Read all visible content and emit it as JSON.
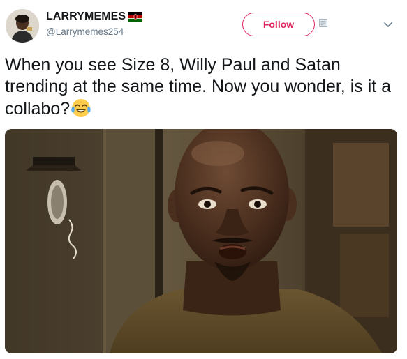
{
  "author": {
    "display_name": "LARRYMEMES",
    "handle": "@Larrymemes254",
    "flag_icon": "kenya-flag-icon"
  },
  "actions": {
    "follow_label": "Follow"
  },
  "tweet": {
    "text": "When you see Size 8, Willy Paul and Satan trending at the same time. Now you wonder, is it a collabo?",
    "emoji": "face-with-tears-of-joy"
  },
  "colors": {
    "follow_accent": "#e0245e",
    "handle_gray": "#657786",
    "text": "#14171a"
  }
}
